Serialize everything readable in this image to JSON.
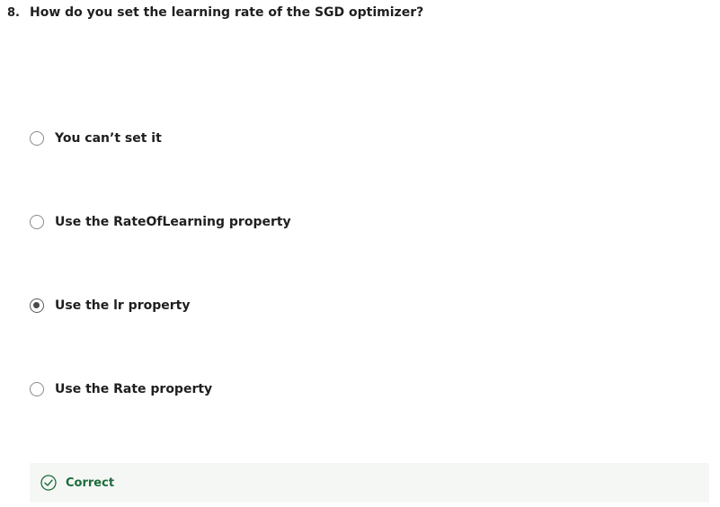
{
  "question": {
    "number": "8.",
    "text": "How do you set the learning rate of the SGD optimizer?"
  },
  "options": [
    {
      "label": "You can’t set it",
      "selected": false
    },
    {
      "label": "Use the RateOfLearning property",
      "selected": false
    },
    {
      "label": "Use the lr property",
      "selected": true
    },
    {
      "label": "Use the Rate property",
      "selected": false
    }
  ],
  "feedback": {
    "status": "Correct",
    "icon": "check-circle-icon",
    "color": "#1b6b3a"
  }
}
